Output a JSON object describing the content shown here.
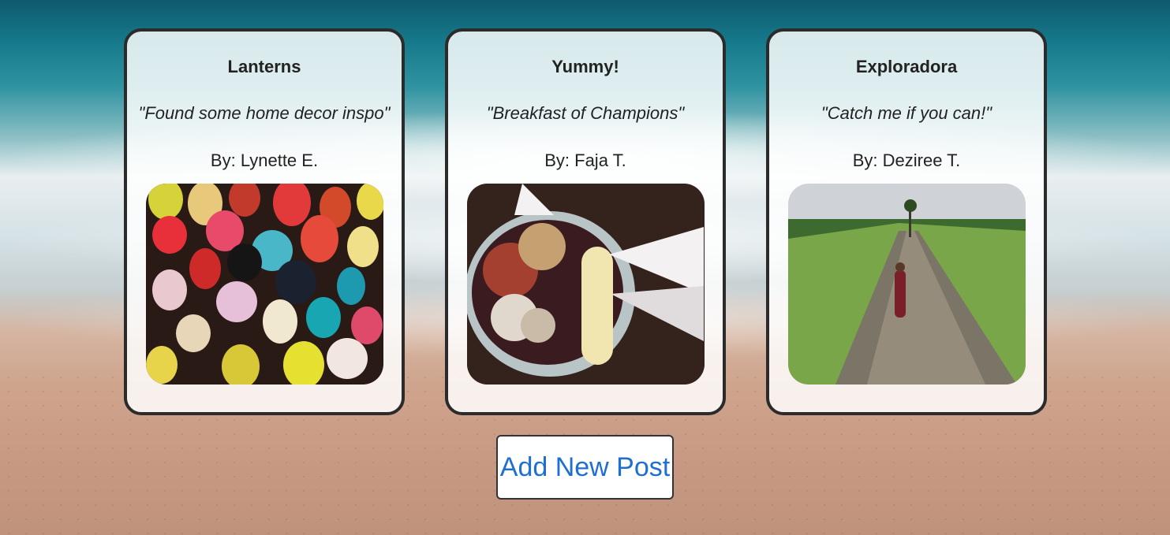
{
  "posts": [
    {
      "title": "Lanterns",
      "caption": "\"Found some home decor inspo\"",
      "author": "By: Lynette E."
    },
    {
      "title": "Yummy!",
      "caption": "\"Breakfast of Champions\"",
      "author": "By: Faja T."
    },
    {
      "title": "Exploradora",
      "caption": "\"Catch me if you can!\"",
      "author": "By: Deziree T."
    }
  ],
  "actions": {
    "add_post_label": "Add New Post"
  },
  "colors": {
    "button_text": "#1f6fd0",
    "card_border": "#2b2b2b",
    "ocean": "#167a8c",
    "sand": "#cfa48d"
  }
}
